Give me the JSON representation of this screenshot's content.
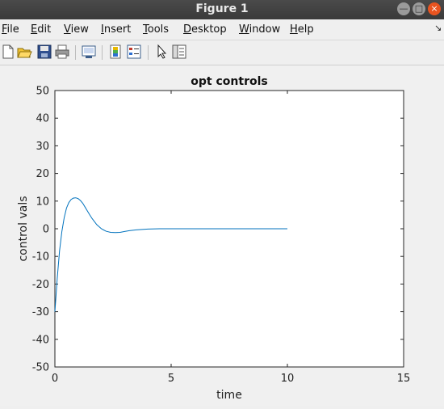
{
  "window": {
    "title": "Figure 1",
    "buttons": {
      "minimize": "—",
      "maximize": "□",
      "close": "×"
    }
  },
  "menu": [
    {
      "underline": "F",
      "rest": "ile"
    },
    {
      "underline": "E",
      "rest": "dit"
    },
    {
      "underline": "V",
      "rest": "iew"
    },
    {
      "underline": "I",
      "rest": "nsert"
    },
    {
      "underline": "T",
      "rest": "ools"
    },
    {
      "underline": "D",
      "rest": "esktop"
    },
    {
      "underline": "W",
      "rest": "indow"
    },
    {
      "underline": "H",
      "rest": "elp"
    }
  ],
  "toolbar_icons": [
    "new-figure-icon",
    "open-file-icon",
    "save-icon",
    "print-icon",
    "print-preview-icon",
    "colorbar-icon",
    "legend-icon",
    "pointer-icon",
    "property-editor-icon"
  ],
  "chart_data": {
    "type": "line",
    "title": "opt controls",
    "xlabel": "time",
    "ylabel": "control vals",
    "xlim": [
      0,
      15
    ],
    "ylim": [
      -50,
      50
    ],
    "xticks": [
      0,
      5,
      10,
      15
    ],
    "yticks": [
      -50,
      -40,
      -30,
      -20,
      -10,
      0,
      10,
      20,
      30,
      40,
      50
    ],
    "grid": false,
    "line_color": "#0072bd",
    "series": [
      {
        "x": [
          0,
          0.1,
          0.2,
          0.3,
          0.4,
          0.5,
          0.6,
          0.7,
          0.8,
          0.9,
          1.0,
          1.1,
          1.2,
          1.3,
          1.4,
          1.5,
          1.6,
          1.8,
          2.0,
          2.2,
          2.4,
          2.6,
          2.8,
          3.0,
          3.2,
          3.5,
          4.0,
          4.5,
          5.0,
          6.0,
          7.0,
          8.0,
          9.0,
          10.0
        ],
        "y": [
          -30,
          -18,
          -8,
          -1,
          4,
          7.5,
          9.5,
          10.6,
          11.1,
          11.2,
          10.9,
          10.2,
          9.2,
          7.8,
          6.4,
          5.0,
          3.7,
          1.5,
          0.0,
          -0.9,
          -1.3,
          -1.4,
          -1.3,
          -1.0,
          -0.7,
          -0.4,
          -0.1,
          0.0,
          0.0,
          0.0,
          0.0,
          0.0,
          0.0,
          0.0
        ]
      }
    ]
  }
}
